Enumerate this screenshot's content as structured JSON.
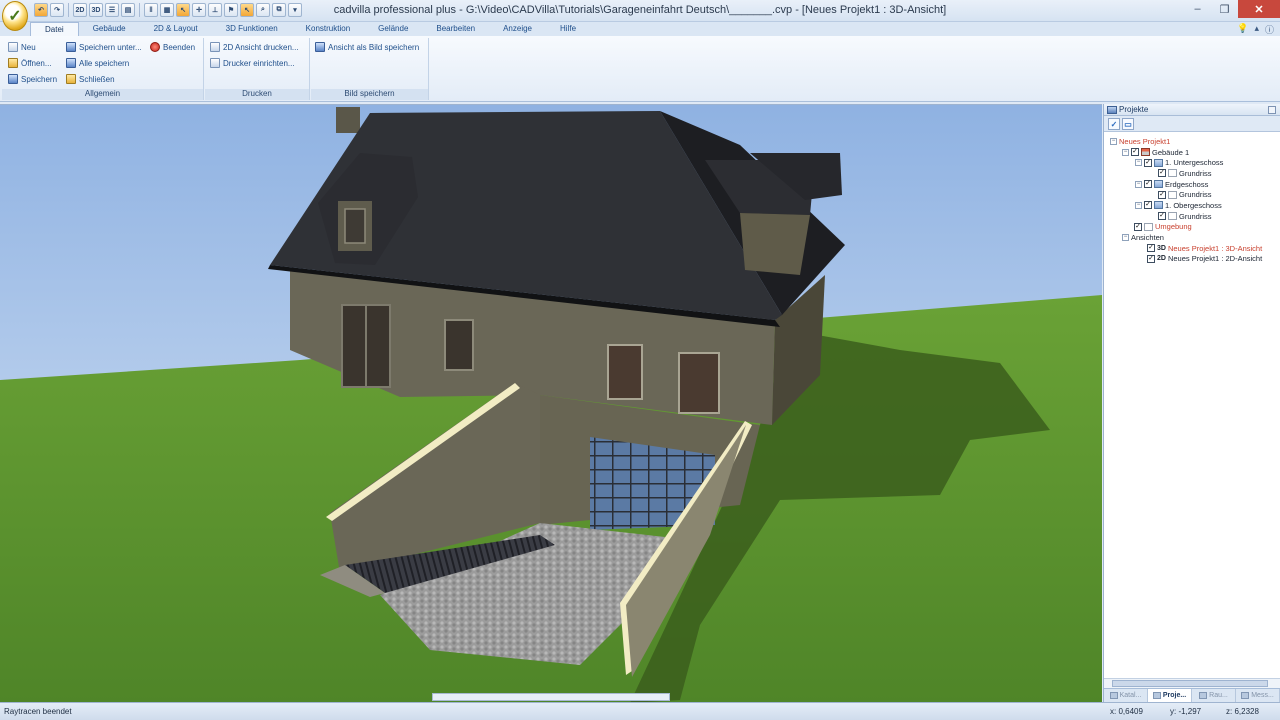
{
  "window": {
    "title": "cadvilla professional plus - G:\\Video\\CADVilla\\Tutorials\\Garageneinfahrt Deutsch\\_______.cvp - [Neues Projekt1 : 3D-Ansicht]"
  },
  "quick_access": {
    "view_2d": "2D",
    "view_3d": "3D"
  },
  "menu": {
    "tabs": [
      "Datei",
      "Gebäude",
      "2D & Layout",
      "3D Funktionen",
      "Konstruktion",
      "Gelände",
      "Bearbeiten",
      "Anzeige",
      "Hilfe"
    ],
    "active_tab": "Datei"
  },
  "ribbon": {
    "allgemein": {
      "title": "Allgemein",
      "neu": "Neu",
      "oeffnen": "Öffnen...",
      "speichern": "Speichern",
      "speichern_unter": "Speichern unter...",
      "alle_speichern": "Alle speichern",
      "schliessen": "Schließen",
      "beenden": "Beenden"
    },
    "drucken": {
      "title": "Drucken",
      "ansicht_drucken": "2D Ansicht drucken...",
      "drucker_einrichten": "Drucker einrichten..."
    },
    "bild_speichern": {
      "title": "Bild speichern",
      "ansicht_als_bild": "Ansicht als Bild speichern"
    }
  },
  "projects_panel": {
    "title": "Projekte",
    "tree": {
      "project": "Neues Projekt1",
      "building": "Gebäude 1",
      "floors": [
        {
          "name": "1. Untergeschoss",
          "child": "Grundriss"
        },
        {
          "name": "Erdgeschoss",
          "child": "Grundriss"
        },
        {
          "name": "1. Obergeschoss",
          "child": "Grundriss"
        }
      ],
      "environment": "Umgebung",
      "views_label": "Ansichten",
      "views": [
        {
          "tag": "3D",
          "name": "Neues Projekt1 : 3D-Ansicht"
        },
        {
          "tag": "2D",
          "name": "Neues Projekt1 : 2D-Ansicht"
        }
      ]
    },
    "bottom_tabs": [
      "Katal...",
      "Proje...",
      "Rau...",
      "Mess..."
    ],
    "active_bottom_tab": "Proje..."
  },
  "status": {
    "message": "Raytracen beendet",
    "x": "x: 0,6409",
    "y": "y: -1,297",
    "z": "z: 6,2328"
  },
  "colors": {
    "sky_top": "#8fb2e2",
    "sky_bottom": "#dbe7f6",
    "grass": "#5d9430",
    "roof": "#2f3136",
    "wall": "#6a6757",
    "retaining_wall_top": "#f2ecc4"
  }
}
